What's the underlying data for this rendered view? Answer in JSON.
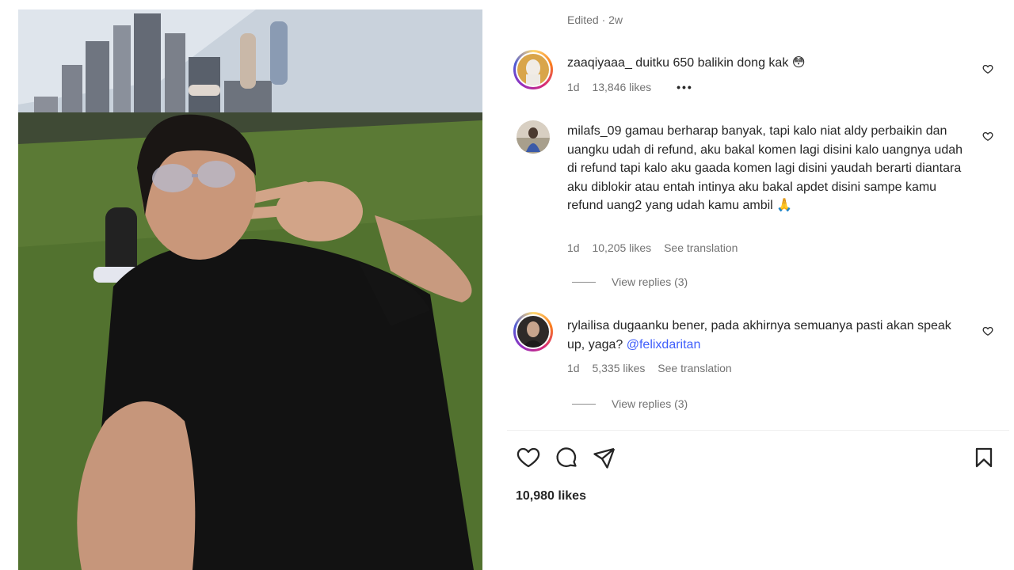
{
  "post": {
    "edited_label": "Edited · 2w",
    "likes_total": "10,980 likes"
  },
  "comments": [
    {
      "username": "zaaqiyaaa_",
      "text": "duitku 650 balikin dong kak 😳",
      "time": "1d",
      "likes": "13,846 likes",
      "more": "•••"
    },
    {
      "username": "milafs_09",
      "text": "gamau berharap banyak, tapi kalo niat aldy perbaikin dan uangku udah di refund, aku bakal komen lagi disini kalo uangnya udah di refund tapi kalo aku gaada komen lagi disini yaudah berarti diantara aku diblokir atau entah intinya aku bakal apdet disini sampe kamu refund uang2 yang udah kamu ambil 🙏",
      "time": "1d",
      "likes": "10,205 likes",
      "translate": "See translation",
      "replies": "View replies (3)"
    },
    {
      "username": "rylailisa",
      "text": "dugaanku bener, pada akhirnya semuanya pasti akan speak up, yaga?",
      "mention": "@felixdaritan",
      "time": "1d",
      "likes": "5,335 likes",
      "translate": "See translation",
      "replies": "View replies (3)"
    }
  ],
  "icons": {
    "like": "heart-icon",
    "comment": "comment-icon",
    "share": "share-icon",
    "save": "bookmark-icon",
    "comment_like": "heart-icon"
  },
  "colors": {
    "text": "#262626",
    "secondary": "#737373",
    "mention": "#3f5efb",
    "divider": "#efefef"
  }
}
